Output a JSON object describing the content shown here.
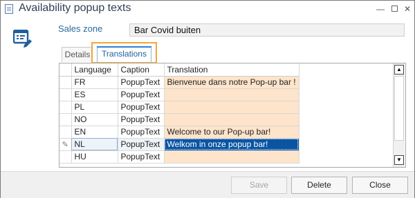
{
  "window": {
    "title": "Availability popup texts",
    "title_icon": "document-icon",
    "controls": [
      "minimize",
      "maximize",
      "close"
    ]
  },
  "form": {
    "icon": "form-edit-icon",
    "sales_zone_label": "Sales zone",
    "sales_zone_value": "Bar Covid buiten"
  },
  "tabs": [
    {
      "label": "Details",
      "active": false
    },
    {
      "label": "Translations",
      "active": true
    }
  ],
  "grid": {
    "columns": [
      "Language",
      "Caption",
      "Translation"
    ],
    "rows": [
      {
        "language": "FR",
        "caption": "PopupText",
        "translation": "Bienvenue dans notre Pop-up bar !"
      },
      {
        "language": "ES",
        "caption": "PopupText",
        "translation": ""
      },
      {
        "language": "PL",
        "caption": "PopupText",
        "translation": ""
      },
      {
        "language": "NO",
        "caption": "PopupText",
        "translation": ""
      },
      {
        "language": "EN",
        "caption": "PopupText",
        "translation": "Welcome to our Pop-up bar!"
      },
      {
        "language": "NL",
        "caption": "PopupText",
        "translation": "Welkom in onze popup bar!",
        "selected": true,
        "editing": true
      },
      {
        "language": "HU",
        "caption": "PopupText",
        "translation": ""
      }
    ],
    "edit_indicator_icon": "pencil-icon"
  },
  "buttons": {
    "save": "Save",
    "delete": "Delete",
    "close": "Close"
  },
  "colors": {
    "translation_cell": "#fde4cb",
    "selection": "#0a54a2",
    "tab_highlight": "#f0a73a"
  }
}
